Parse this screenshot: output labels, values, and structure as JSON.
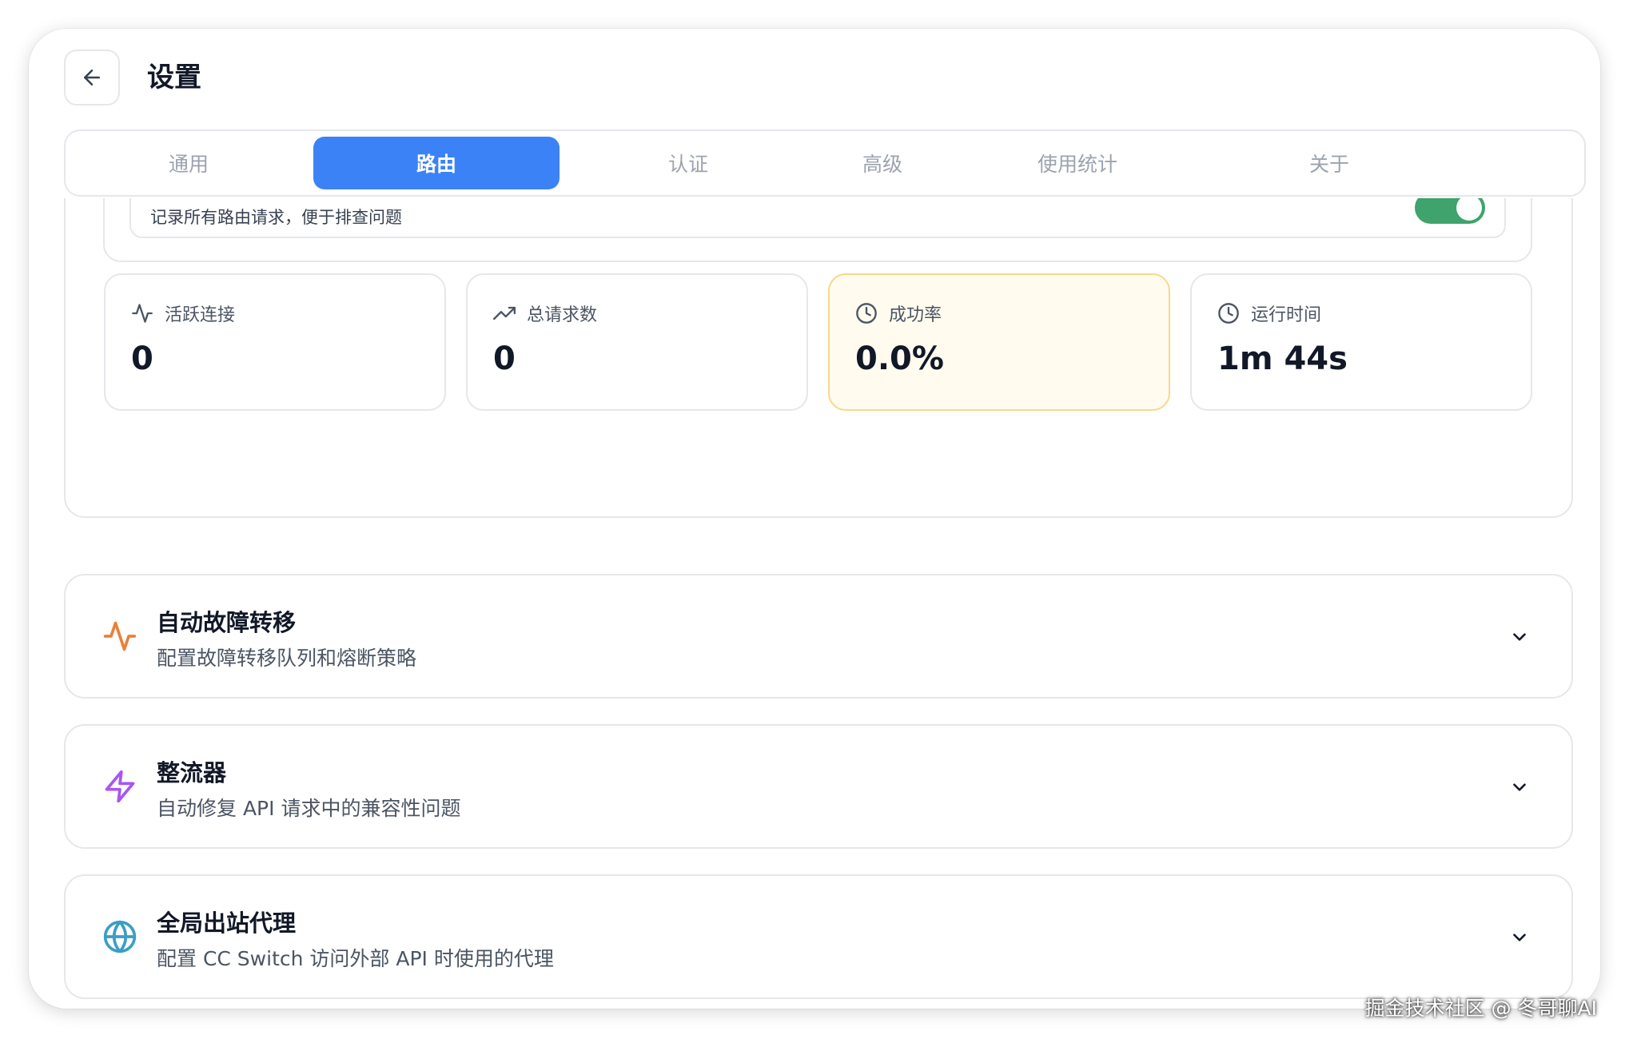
{
  "header": {
    "title": "设置",
    "back_icon": "arrow-left-icon"
  },
  "tabs": [
    {
      "label": "通用",
      "active": false
    },
    {
      "label": "路由",
      "active": true
    },
    {
      "label": "认证",
      "active": false
    },
    {
      "label": "高级",
      "active": false
    },
    {
      "label": "使用统计",
      "active": false
    },
    {
      "label": "关于",
      "active": false
    }
  ],
  "logging": {
    "description": "记录所有路由请求，便于排查问题",
    "enabled": true
  },
  "stats": [
    {
      "label": "活跃连接",
      "value": "0",
      "icon": "activity-icon"
    },
    {
      "label": "总请求数",
      "value": "0",
      "icon": "trending-up-icon"
    },
    {
      "label": "成功率",
      "value": "0.0%",
      "icon": "clock-icon",
      "highlight": true
    },
    {
      "label": "运行时间",
      "value": "1m 44s",
      "icon": "clock-icon"
    }
  ],
  "accordions": [
    {
      "title": "自动故障转移",
      "subtitle": "配置故障转移队列和熔断策略",
      "icon": "activity-icon",
      "color": "#e8823a"
    },
    {
      "title": "整流器",
      "subtitle": "自动修复 API 请求中的兼容性问题",
      "icon": "zap-icon",
      "color": "#a855f7"
    },
    {
      "title": "全局出站代理",
      "subtitle": "配置 CC Switch 访问外部 API 时使用的代理",
      "icon": "globe-icon",
      "color": "#3b9ec4"
    }
  ],
  "colors": {
    "accent": "#3b82f6",
    "toggle_on": "#3ea36c",
    "warn_bg": "#fffbef",
    "warn_border": "#f6d98a"
  },
  "watermark": "掘金技术社区 @ 冬哥聊AI"
}
